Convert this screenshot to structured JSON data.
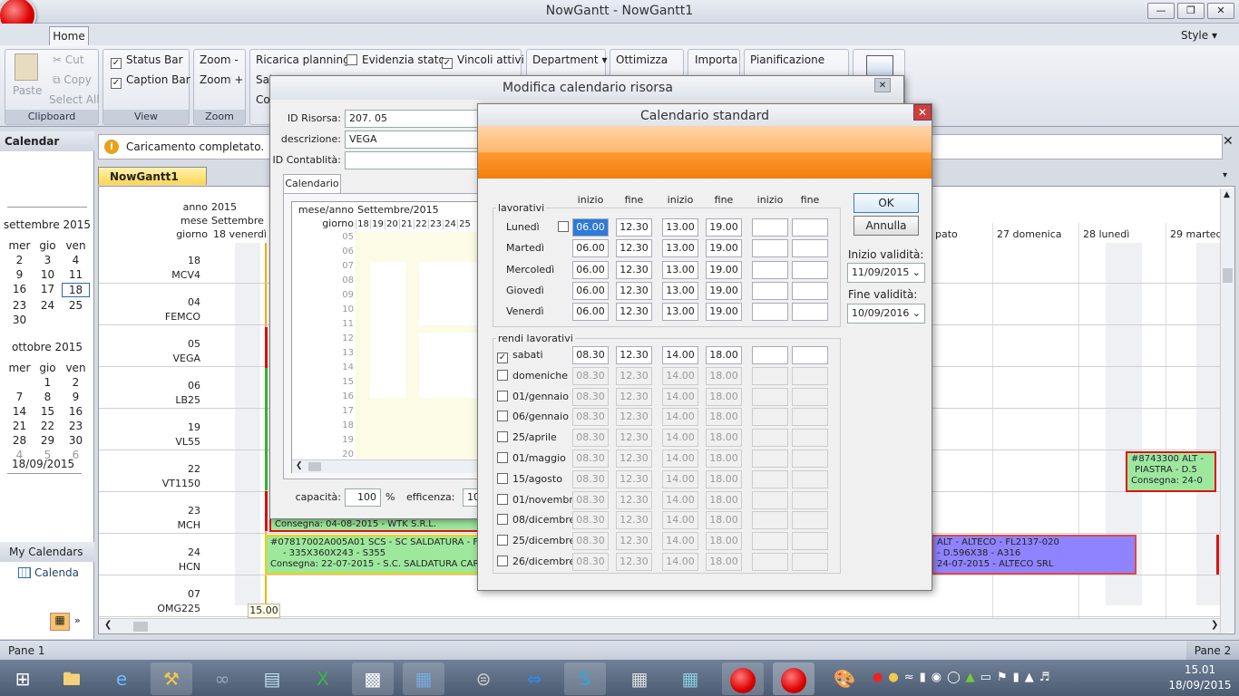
{
  "window": {
    "title": "NowGantt - NowGantt1"
  },
  "ribbon": {
    "tab_home": "Home",
    "style": "Style",
    "clipboard": {
      "paste": "Paste",
      "cut": "Cut",
      "copy": "Copy",
      "select_all": "Select All",
      "label": "Clipboard"
    },
    "view": {
      "status_bar": "Status Bar",
      "caption_bar": "Caption Bar",
      "label": "View"
    },
    "zoom": {
      "zoom_out": "Zoom -",
      "zoom_in": "Zoom +",
      "label": "Zoom"
    },
    "planning": {
      "reload": "Ricarica planning",
      "evidenzia": "Evidenzia stato",
      "vincoli": "Vincoli attivi",
      "sal": "Sal",
      "co": "Co"
    },
    "department": "Department",
    "ottimizza": "Ottimizza",
    "importa": "Importa",
    "pianificazione": "Pianificazione",
    "ws": "ws"
  },
  "left_pane": {
    "header": "Calendar",
    "sept": {
      "title": "settembre 2015",
      "days": [
        "mer",
        "gio",
        "ven"
      ],
      "cells": [
        "2",
        "3",
        "4",
        "9",
        "10",
        "11",
        "16",
        "17",
        "18",
        "23",
        "24",
        "25",
        "30",
        "",
        ""
      ]
    },
    "oct": {
      "title": "ottobre 2015",
      "days": [
        "mer",
        "gio",
        "ven"
      ],
      "cells": [
        "",
        "1",
        "2",
        "7",
        "8",
        "9",
        "14",
        "15",
        "16",
        "21",
        "22",
        "23",
        "28",
        "29",
        "30",
        "4",
        "5",
        "6"
      ]
    },
    "today": "18/09/2015",
    "my_calendars": "My Calendars",
    "calendar_item": "Calenda"
  },
  "infobar": {
    "text": "Caricamento completato."
  },
  "doc_tab": "NowGantt1",
  "gantt": {
    "hdr_anno_label": "anno",
    "hdr_anno": "2015",
    "hdr_mese_label": "mese",
    "hdr_mese": "Settembre",
    "hdr_giorno_label": "giorno",
    "hdr_giorno": "18 venerdì",
    "day_cols": [
      "pato",
      "27 domenica",
      "28 lunedì",
      "29 martedì"
    ],
    "resources": [
      {
        "code": "18",
        "name": "MCV4"
      },
      {
        "code": "04",
        "name": "FEMCO"
      },
      {
        "code": "05",
        "name": "VEGA"
      },
      {
        "code": "06",
        "name": "LB25"
      },
      {
        "code": "19",
        "name": "VL55"
      },
      {
        "code": "22",
        "name": "VT1150"
      },
      {
        "code": "23",
        "name": "MCH"
      },
      {
        "code": "24",
        "name": "HCN"
      },
      {
        "code": "07",
        "name": "OMG225"
      }
    ],
    "bar1": "Consegna: 04-08-2015 - WTK S.R.L.",
    "bar2": {
      "l1": "#07817002A005A01 SCS - SC SALDATURA - FL2",
      "l2": "- 335X360X243 - S355",
      "l3": "Consegna: 22-07-2015 - S.C. SALDATURA CARPI"
    },
    "bar3": {
      "l1": "ALT - ALTECO - FL2137-020",
      "l2": "- D.596X38 - A316",
      "l3": "24-07-2015 - ALTECO SRL"
    },
    "bar4": {
      "l1": "#8743300 ALT -",
      "l2": "PIASTRA - D.5",
      "l3": "Consegna: 24-0"
    },
    "time_box": "15.00"
  },
  "dlg_res": {
    "title": "Modifica calendario risorsa",
    "id_risorsa_label": "ID Risorsa:",
    "id_risorsa": "207. 05",
    "descr_label": "descrizione:",
    "descr": "VEGA",
    "idcont_label": "ID Contablità:",
    "tab": "Calendario",
    "mese_anno_label": "mese/anno",
    "mese_anno": "Settembre/2015",
    "giorno_label": "giorno",
    "days": [
      "18",
      "19",
      "20",
      "21",
      "22",
      "23",
      "24",
      "25",
      "2"
    ],
    "hours": [
      "05",
      "06",
      "07",
      "08",
      "09",
      "10",
      "11",
      "12",
      "13",
      "14",
      "15",
      "16",
      "17",
      "18",
      "19",
      "20"
    ],
    "capacita_label": "capacità:",
    "capacita": "100",
    "pct": "%",
    "efficenza_label": "efficenza:",
    "efficenza": "10"
  },
  "dlg_std": {
    "title": "Calendario standard",
    "headers": [
      "inizio",
      "fine",
      "inizio",
      "fine",
      "inizio",
      "fine"
    ],
    "lavorativi_label": "lavorativi",
    "weekdays": [
      {
        "day": "Lunedì",
        "v": [
          "06.00",
          "12.30",
          "13.00",
          "19.00",
          "",
          ""
        ]
      },
      {
        "day": "Martedì",
        "v": [
          "06.00",
          "12.30",
          "13.00",
          "19.00",
          "",
          ""
        ]
      },
      {
        "day": "Mercoledì",
        "v": [
          "06.00",
          "12.30",
          "13.00",
          "19.00",
          "",
          ""
        ]
      },
      {
        "day": "Giovedì",
        "v": [
          "06.00",
          "12.30",
          "13.00",
          "19.00",
          "",
          ""
        ]
      },
      {
        "day": "Venerdì",
        "v": [
          "06.00",
          "12.30",
          "13.00",
          "19.00",
          "",
          ""
        ]
      }
    ],
    "rendi_label": "rendi lavorativi",
    "holidays": [
      {
        "day": "sabati",
        "checked": true,
        "v": [
          "08.30",
          "12.30",
          "14.00",
          "18.00",
          "",
          ""
        ]
      },
      {
        "day": "domeniche",
        "checked": false,
        "v": [
          "08.30",
          "12.30",
          "14.00",
          "18.00",
          "",
          ""
        ]
      },
      {
        "day": "01/gennaio",
        "checked": false,
        "v": [
          "08.30",
          "12.30",
          "14.00",
          "18.00",
          "",
          ""
        ]
      },
      {
        "day": "06/gennaio",
        "checked": false,
        "v": [
          "08.30",
          "12.30",
          "14.00",
          "18.00",
          "",
          ""
        ]
      },
      {
        "day": "25/aprile",
        "checked": false,
        "v": [
          "08.30",
          "12.30",
          "14.00",
          "18.00",
          "",
          ""
        ]
      },
      {
        "day": "01/maggio",
        "checked": false,
        "v": [
          "08.30",
          "12.30",
          "14.00",
          "18.00",
          "",
          ""
        ]
      },
      {
        "day": "15/agosto",
        "checked": false,
        "v": [
          "08.30",
          "12.30",
          "14.00",
          "18.00",
          "",
          ""
        ]
      },
      {
        "day": "01/novembre",
        "checked": false,
        "v": [
          "08.30",
          "12.30",
          "14.00",
          "18.00",
          "",
          ""
        ]
      },
      {
        "day": "08/dicembre",
        "checked": false,
        "v": [
          "08.30",
          "12.30",
          "14.00",
          "18.00",
          "",
          ""
        ]
      },
      {
        "day": "25/dicembre",
        "checked": false,
        "v": [
          "08.30",
          "12.30",
          "14.00",
          "18.00",
          "",
          ""
        ]
      },
      {
        "day": "26/dicembre",
        "checked": false,
        "v": [
          "08.30",
          "12.30",
          "14.00",
          "18.00",
          "",
          ""
        ]
      }
    ],
    "ok": "OK",
    "annulla": "Annulla",
    "inizio_validita_label": "Inizio validità:",
    "inizio_validita": "11/09/2015",
    "fine_validita_label": "Fine validità:",
    "fine_validita": "10/09/2016"
  },
  "status": {
    "pane1": "Pane 1",
    "pane2": "Pane 2"
  },
  "taskbar": {
    "time": "15.01",
    "date": "18/09/2015"
  }
}
